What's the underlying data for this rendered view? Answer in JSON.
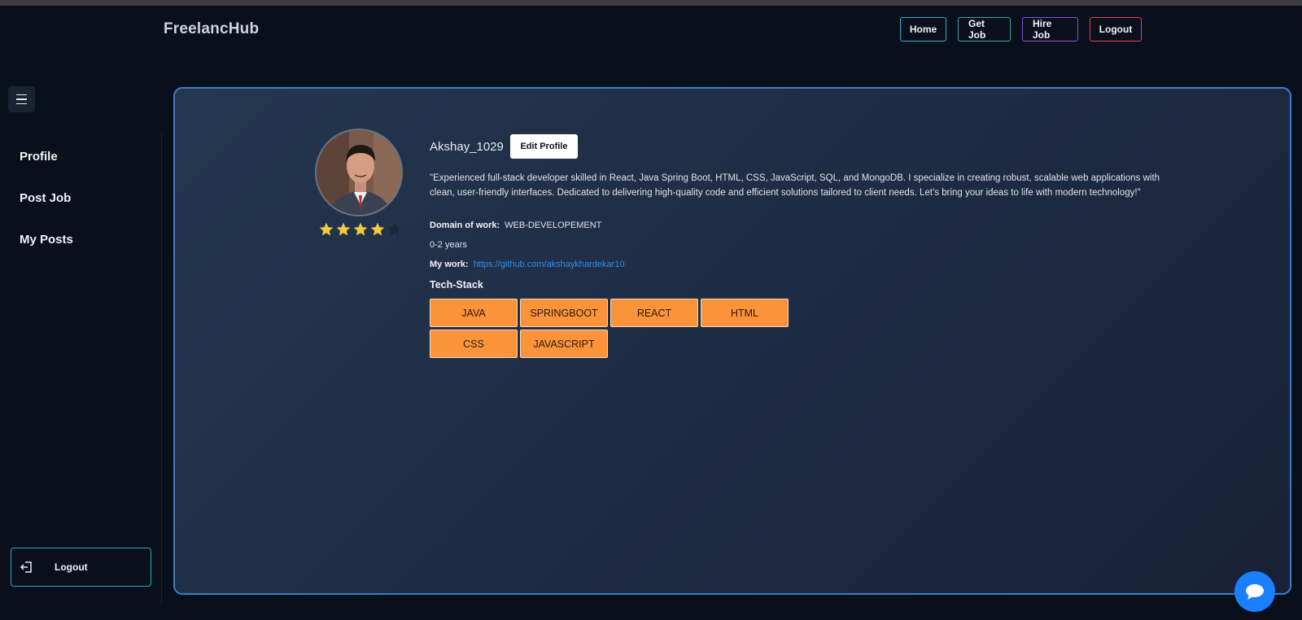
{
  "header": {
    "brand": "FreelancHub",
    "nav": [
      {
        "label": "Home"
      },
      {
        "label": "Get Job"
      },
      {
        "label": "Hire Job"
      },
      {
        "label": "Logout"
      }
    ]
  },
  "sidebar": {
    "items": [
      {
        "label": "Profile"
      },
      {
        "label": "Post Job"
      },
      {
        "label": "My Posts"
      }
    ],
    "logout_label": "Logout"
  },
  "profile": {
    "username": "Akshay_1029",
    "edit_label": "Edit Profile",
    "rating": 4,
    "rating_max": 5,
    "bio": "\"Experienced full-stack developer skilled in React, Java Spring Boot, HTML, CSS, JavaScript, SQL, and MongoDB. I specialize in creating robust, scalable web applications with clean, user-friendly interfaces. Dedicated to delivering high-quality code and efficient solutions tailored to client needs. Let’s bring your ideas to life with modern technology!\"",
    "domain_label": "Domain of work:",
    "domain_value": "WEB-DEVELOPEMENT",
    "experience": "0-2 years",
    "work_label": "My work:",
    "work_link": "https://github.com/akshaykhardekar10",
    "tech_title": "Tech-Stack",
    "tech_stack": [
      "JAVA",
      "SPRINGBOOT",
      "REACT",
      "HTML",
      "CSS",
      "JAVASCRIPT"
    ]
  },
  "colors": {
    "background": "#0a0f1c",
    "card_border": "#3d7fc2",
    "tech_chip": "#fb933b",
    "link": "#2f8fef",
    "star_filled": "#f5c842",
    "chat_button": "#1a7fff"
  },
  "icons": {
    "menu": "hamburger-icon",
    "logout": "logout-icon",
    "star": "star-icon",
    "chat": "chat-bubble-icon"
  }
}
